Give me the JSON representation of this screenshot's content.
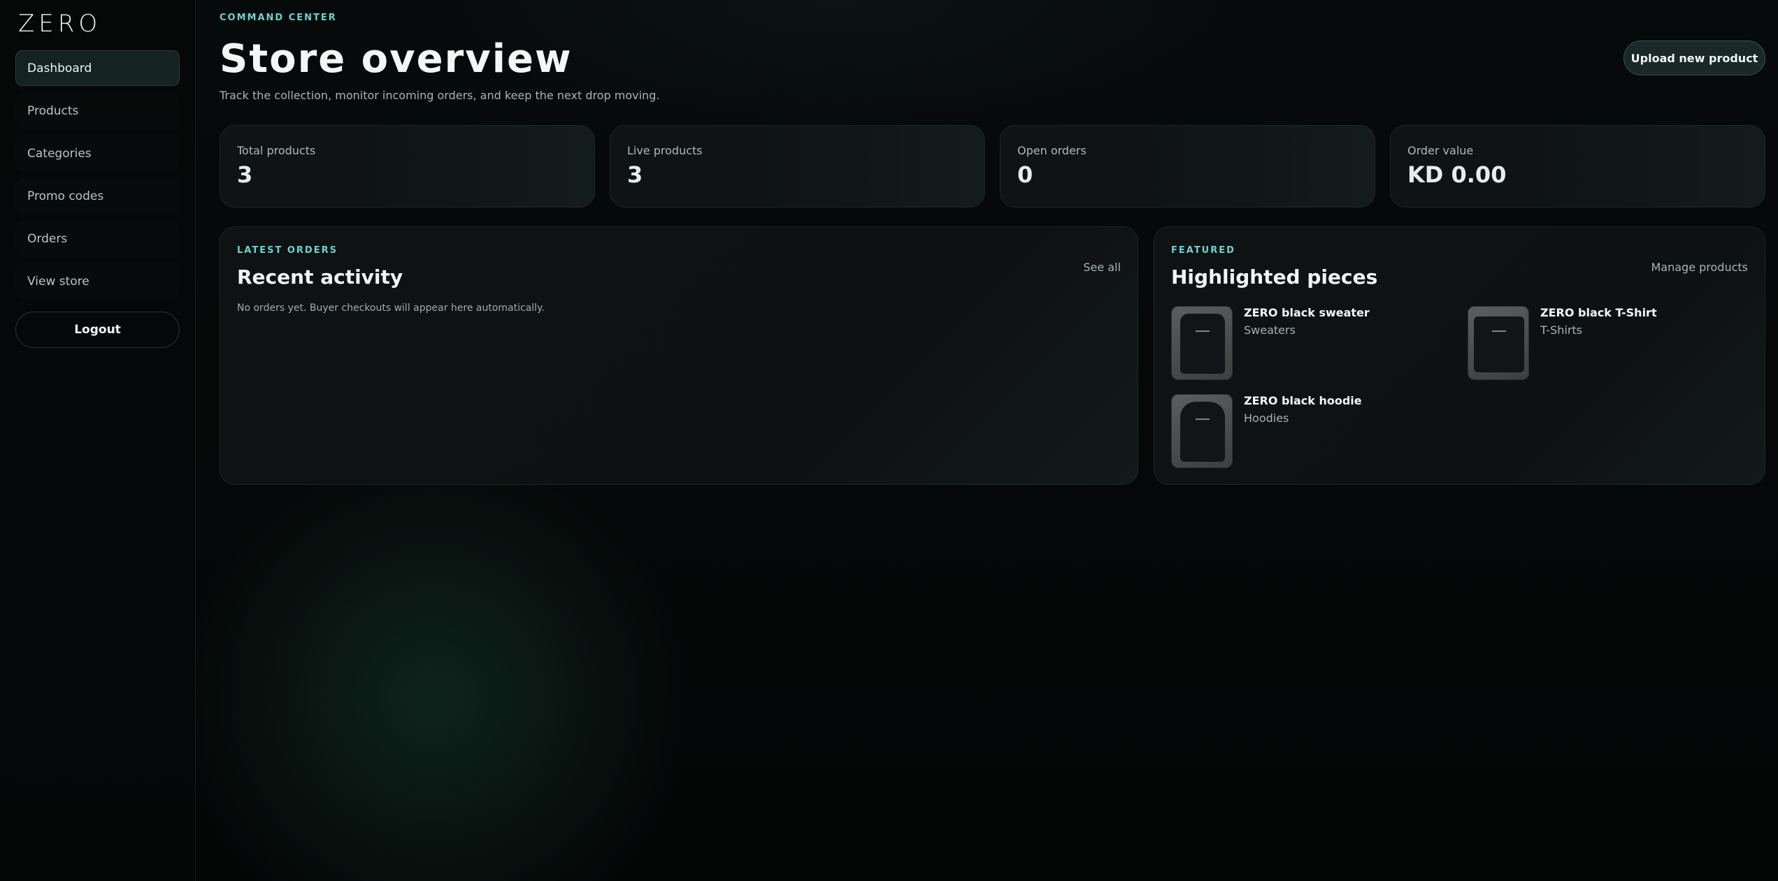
{
  "brand": {
    "logo": "ZERO"
  },
  "sidebar": {
    "items": [
      {
        "label": "Dashboard",
        "active": true
      },
      {
        "label": "Products"
      },
      {
        "label": "Categories"
      },
      {
        "label": "Promo codes"
      },
      {
        "label": "Orders"
      },
      {
        "label": "View store"
      }
    ],
    "logout_label": "Logout"
  },
  "header": {
    "eyebrow": "COMMAND CENTER",
    "title": "Store overview",
    "subtitle": "Track the collection, monitor incoming orders, and keep the next drop moving.",
    "upload_label": "Upload new product"
  },
  "stats": [
    {
      "label": "Total products",
      "value": "3"
    },
    {
      "label": "Live products",
      "value": "3"
    },
    {
      "label": "Open orders",
      "value": "0"
    },
    {
      "label": "Order value",
      "value": "KD 0.00"
    }
  ],
  "orders_panel": {
    "eyebrow": "LATEST ORDERS",
    "title": "Recent activity",
    "link": "See all",
    "empty_text": "No orders yet. Buyer checkouts will appear here automatically."
  },
  "featured_panel": {
    "eyebrow": "FEATURED",
    "title": "Highlighted pieces",
    "link": "Manage products",
    "products": [
      {
        "name": "ZERO black sweater",
        "category": "Sweaters",
        "icon": "sweater-image"
      },
      {
        "name": "ZERO black T-Shirt",
        "category": "T-Shirts",
        "icon": "tshirt-image"
      },
      {
        "name": "ZERO black hoodie",
        "category": "Hoodies",
        "icon": "hoodie-image"
      }
    ]
  },
  "colors": {
    "accent": "#67d5d0",
    "background": "#050707",
    "active_nav": "#142221"
  }
}
